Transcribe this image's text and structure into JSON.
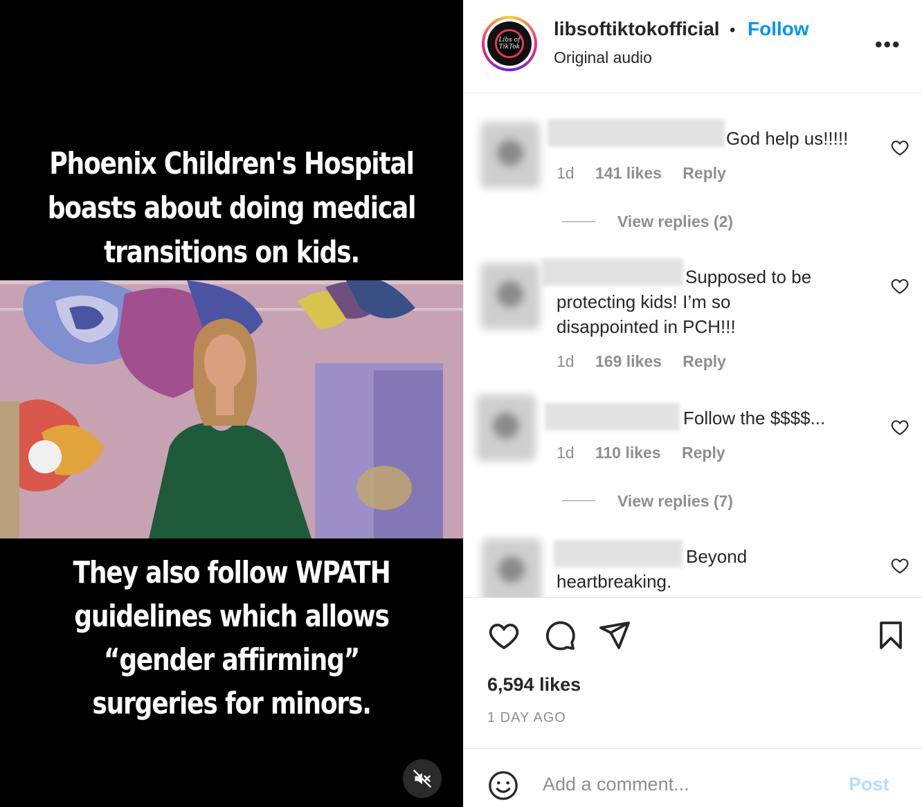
{
  "video": {
    "caption_top": "Phoenix Children's Hospital boasts about doing medical transitions on kids.",
    "caption_bottom": "They also follow WPATH guidelines which allows “gender affirming” surgeries for minors.",
    "mute_icon": "speaker-muted-icon"
  },
  "header": {
    "avatar_text_line1": "Libs of",
    "avatar_text_line2": "TikTok",
    "username": "libsoftiktokofficial",
    "separator": "•",
    "follow_label": "Follow",
    "audio": "Original audio",
    "more_label": "•••"
  },
  "comments": [
    {
      "text": "God help us!!!!!",
      "time": "1d",
      "likes": "141 likes",
      "reply": "Reply",
      "replies_label": "View replies (2)"
    },
    {
      "text_line1": "Supposed to be",
      "text_line2": "protecting kids! I’m so",
      "text_line3": "disappointed in PCH!!!",
      "time": "1d",
      "likes": "169 likes",
      "reply": "Reply"
    },
    {
      "text": "Follow the $$$$...",
      "time": "1d",
      "likes": "110 likes",
      "reply": "Reply",
      "replies_label": "View replies (7)"
    },
    {
      "text_line1": "Beyond",
      "text_line2": "heartbreaking."
    }
  ],
  "actions": {
    "likes": "6,594 likes",
    "date": "1 DAY AGO",
    "icons": [
      "heart-icon",
      "comment-icon",
      "share-icon",
      "bookmark-icon"
    ]
  },
  "add_comment": {
    "placeholder": "Add a comment...",
    "post_label": "Post"
  },
  "colors": {
    "accent": "#0095f6",
    "post_disabled": "#b2dffc",
    "muted_text": "#8e8e8e"
  }
}
